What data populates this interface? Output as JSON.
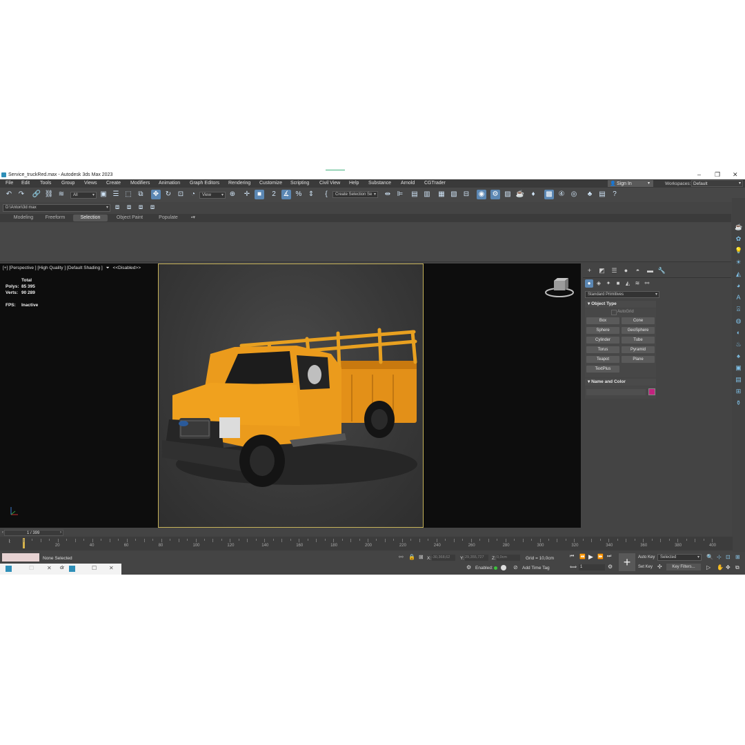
{
  "title_bar": {
    "title": "Service_truckRed.max - Autodesk 3ds Max 2023"
  },
  "menu": [
    "File",
    "Edit",
    "Tools",
    "Group",
    "Views",
    "Create",
    "Modifiers",
    "Animation",
    "Graph Editors",
    "Rendering",
    "Customize",
    "Scripting",
    "Civil View",
    "Help",
    "Substance",
    "Arnold",
    "CGTrader"
  ],
  "signin": {
    "label": "Sign In"
  },
  "workspaces": {
    "label": "Workspaces:",
    "value": "Default"
  },
  "toolbar": {
    "filter_value": "All",
    "refcoord_value": "View",
    "selection_set_placeholder": "Create Selection Se"
  },
  "path": {
    "project": "D:\\Anton\\3d max"
  },
  "ribbon_tabs": [
    "Modeling",
    "Freeform",
    "Selection",
    "Object Paint",
    "Populate"
  ],
  "viewport": {
    "label": "[+] [Perspective ] [High Quality ] [Default Shading ]",
    "disabled_label": "<<Disabled>>",
    "stats": {
      "total_label": "Total",
      "polys_label": "Polys:",
      "polys_value": "85 395",
      "verts_label": "Verts:",
      "verts_value": "90 289",
      "fps_label": "FPS:",
      "fps_value": "Inactive"
    }
  },
  "command_panel": {
    "category": "Standard Primitives",
    "object_type_title": "Object Type",
    "autogrid": "AutoGrid",
    "buttons": [
      "Box",
      "Cone",
      "Sphere",
      "GeoSphere",
      "Cylinder",
      "Tube",
      "Torus",
      "Pyramid",
      "Teapot",
      "Plane",
      "TextPlus"
    ],
    "name_color_title": "Name and Color",
    "object_color": "#c2237e"
  },
  "timeline": {
    "frame": "1 / 399",
    "ticks": [
      "20",
      "40",
      "60",
      "80",
      "100",
      "120",
      "140",
      "160",
      "180",
      "200",
      "220",
      "240",
      "260",
      "280",
      "300",
      "320",
      "340",
      "360",
      "380",
      "400"
    ]
  },
  "status": {
    "selection": "None Selected",
    "x_label": "X:",
    "x_value": "-30,368,62",
    "y_label": "Y:",
    "y_value": "29,355,727",
    "z_label": "Z:",
    "z_value": "0,0cm",
    "grid": "Grid = 10,0cm",
    "enabled": "Enabled:",
    "add_time_tag": "Add Time Tag",
    "auto_key": "Auto Key",
    "set_key": "Set Key",
    "key_mode_value": "Selected",
    "key_filters": "Key Filters...",
    "frame_field": "1"
  },
  "colors": {
    "accent": "#5b87b3",
    "truck": "#f0a11e",
    "safe_frame": "#c8b45a"
  }
}
